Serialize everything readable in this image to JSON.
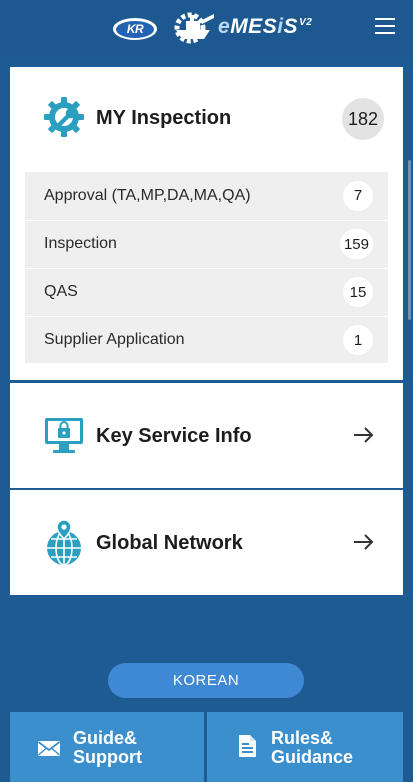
{
  "header": {
    "logo_text": "KR",
    "brand_e": "e",
    "brand_main": "MES",
    "brand_i": "i",
    "brand_s": "S",
    "brand_version": "V2"
  },
  "inspection": {
    "title": "MY Inspection",
    "total": "182",
    "items": [
      {
        "label": "Approval (TA,MP,DA,MA,QA)",
        "count": "7"
      },
      {
        "label": "Inspection",
        "count": "159"
      },
      {
        "label": "QAS",
        "count": "15"
      },
      {
        "label": "Supplier Application",
        "count": "1"
      }
    ]
  },
  "key_service": {
    "title": "Key Service Info"
  },
  "global_network": {
    "title": "Global Network"
  },
  "language_button": "KOREAN",
  "bottom": {
    "guide_label": "Guide&\nSupport",
    "rules_label": "Rules&\nGuidance"
  },
  "icons": {
    "inspection": "gear-wrench-icon",
    "key_service": "monitor-lock-icon",
    "global_network": "globe-pin-icon",
    "arrow": "arrow-right-icon",
    "guide": "envelope-icon",
    "rules": "document-icon",
    "menu": "hamburger-menu-icon"
  },
  "colors": {
    "background": "#1e5b93",
    "accent": "#3a8fcc",
    "icon_teal": "#2a9fbf",
    "korean_button": "#3f88d3"
  }
}
